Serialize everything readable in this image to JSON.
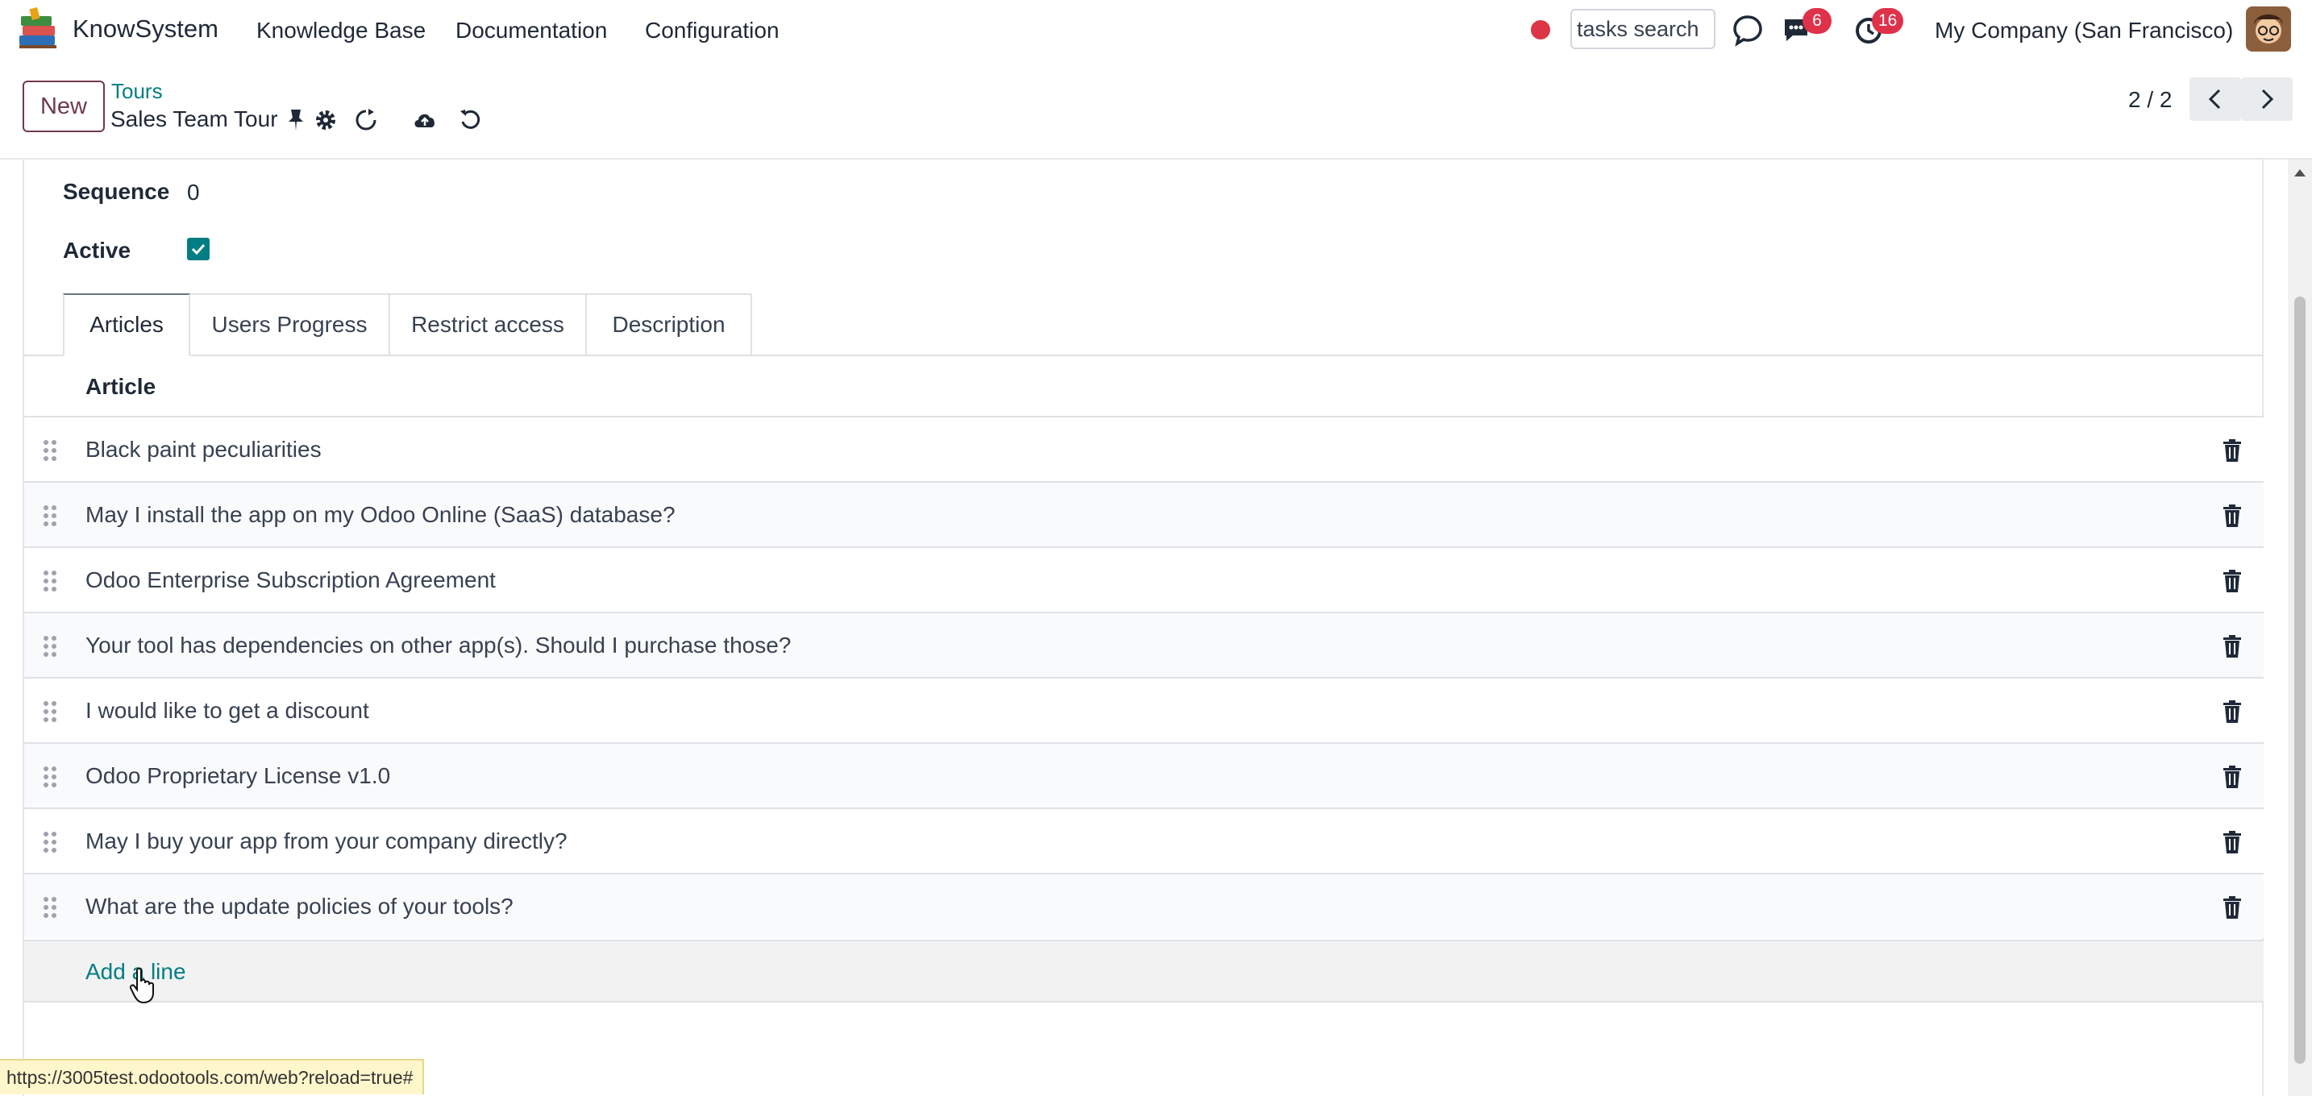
{
  "navbar": {
    "app_name": "KnowSystem",
    "menu": [
      "Knowledge Base",
      "Documentation",
      "Configuration"
    ],
    "search_placeholder": "tasks search",
    "messages_count": "6",
    "activities_count": "16",
    "company": "My Company (San Francisco)"
  },
  "control_panel": {
    "new_label": "New",
    "breadcrumb": "Tours",
    "record_title": "Sales Team Tour",
    "pager": "2 / 2"
  },
  "form": {
    "sequence_label": "Sequence",
    "sequence_value": "0",
    "active_label": "Active",
    "active_checked": true,
    "tabs": [
      {
        "label": "Articles",
        "active": true
      },
      {
        "label": "Users Progress",
        "active": false
      },
      {
        "label": "Restrict access",
        "active": false
      },
      {
        "label": "Description",
        "active": false
      }
    ],
    "list_header": "Article",
    "articles": [
      "Black paint peculiarities",
      "May I install the app on my Odoo Online (SaaS) database?",
      "Odoo Enterprise Subscription Agreement",
      "Your tool has dependencies on other app(s). Should I purchase those?",
      "I would like to get a discount",
      "Odoo Proprietary License v1.0",
      "May I buy your app from your company directly?",
      "What are the update policies of your tools?"
    ],
    "add_line_label": "Add a line"
  },
  "status_url": "https://3005test.odootools.com/web?reload=true#",
  "colors": {
    "brand": "#71394a",
    "accent": "#017e84",
    "badge": "#e0314b",
    "record_dot": "#dc3545"
  },
  "icons": [
    "books-logo-icon",
    "pin-icon",
    "gear-icon",
    "refresh-icon",
    "cloud-upload-icon",
    "undo-icon",
    "chat-bubble-icon",
    "messages-icon",
    "clock-icon",
    "chevron-left-icon",
    "chevron-right-icon",
    "drag-handle-icon",
    "trash-icon"
  ]
}
